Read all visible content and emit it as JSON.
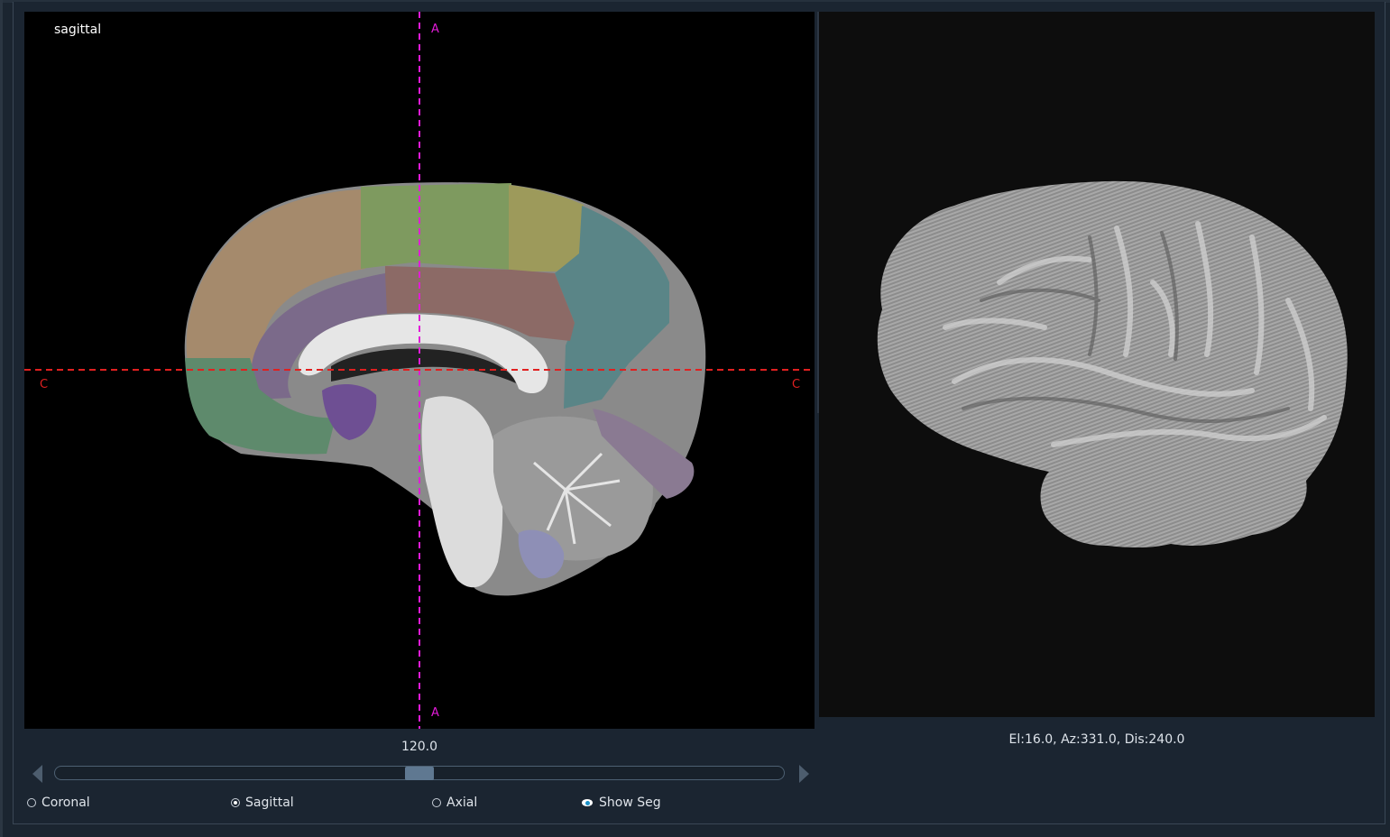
{
  "viewer2d": {
    "view_label": "sagittal",
    "orientation_top": "A",
    "orientation_bottom": "A",
    "orientation_left": "C",
    "orientation_right": "C",
    "crosshair_colors": {
      "vertical": "#e21bd8",
      "horizontal": "#e02020"
    }
  },
  "viewer3d": {
    "camera_info": "El:16.0, Az:331.0, Dis:240.0"
  },
  "slice": {
    "value": "120.0",
    "slider_fraction": 0.5
  },
  "controls": {
    "coronal_label": "Coronal",
    "sagittal_label": "Sagittal",
    "axial_label": "Axial",
    "show_seg_label": "Show Seg",
    "selected_view": "Sagittal",
    "show_seg_checked": true
  },
  "icons": {
    "prev": "triangle-left-icon",
    "next": "triangle-right-icon",
    "show_seg": "eye-icon"
  }
}
